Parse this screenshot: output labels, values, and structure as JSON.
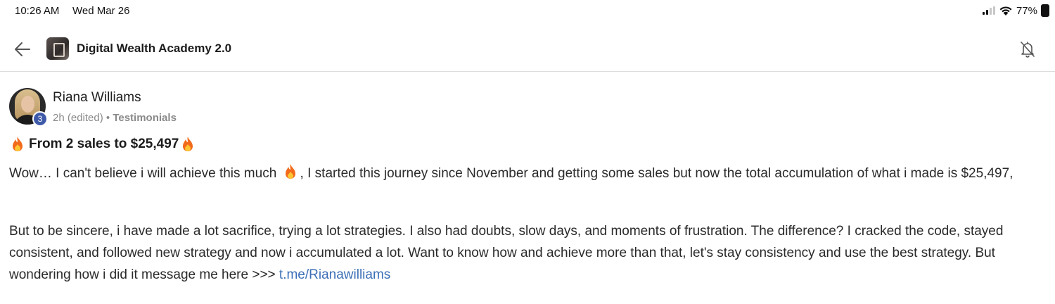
{
  "status_bar": {
    "time": "10:26 AM",
    "date": "Wed Mar 26",
    "battery": "77%",
    "icons": [
      "signal-icon",
      "wifi-icon",
      "battery-icon"
    ]
  },
  "header": {
    "title": "Digital Wealth Academy 2.0",
    "icons": [
      "back-arrow-icon",
      "group-logo",
      "bell-off-icon"
    ]
  },
  "post": {
    "author": "Riana Williams",
    "level": "3",
    "time": "2h (edited)",
    "separator": "•",
    "category": "Testimonials",
    "title": "From 2 sales to $25,497",
    "paragraph1_a": "Wow… I can't believe i will achieve this much",
    "paragraph1_b": ", I started this journey since November and getting some sales but now the total accumulation of what i made is $25,497,",
    "paragraph2": "But to be sincere, i have made a lot sacrifice, trying a lot strategies. I also had doubts, slow days, and moments of frustration. The difference? I cracked the code, stayed consistent, and followed new strategy and now i accumulated a lot. Want to know how and achieve more than that, let's stay consistency and use the best strategy. But wondering how i did it message me here >>>",
    "link_text": "t.me/Rianawilliams",
    "link_color": "#3b6fb6",
    "emoji": "fire-icon"
  }
}
